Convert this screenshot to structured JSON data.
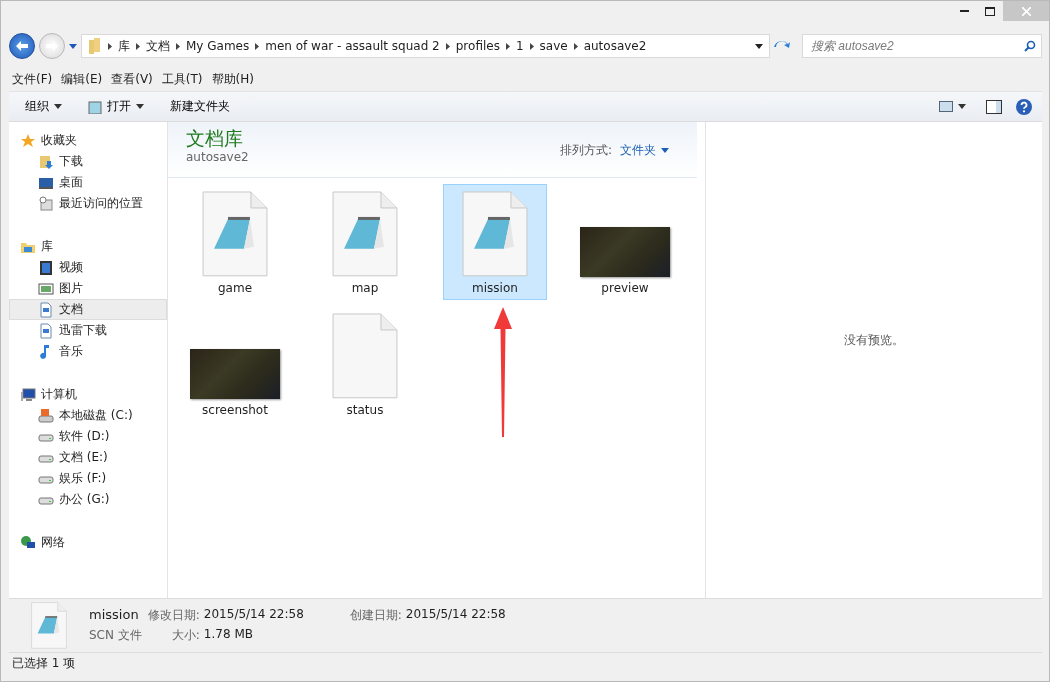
{
  "address": {
    "crumbs": [
      "库",
      "文档",
      "My Games",
      "men of war - assault squad 2",
      "profiles",
      "1",
      "save",
      "autosave2"
    ]
  },
  "search": {
    "placeholder": "搜索 autosave2"
  },
  "menu": [
    "文件(F)",
    "编辑(E)",
    "查看(V)",
    "工具(T)",
    "帮助(H)"
  ],
  "toolbar": [
    {
      "label": "组织",
      "kind": "dropdown"
    },
    {
      "label": "打开",
      "kind": "open"
    },
    {
      "label": "新建文件夹",
      "kind": "plain"
    }
  ],
  "sidebar": [
    {
      "label": "收藏夹",
      "kind": "star",
      "selected": false,
      "children": [
        {
          "label": "下载",
          "kind": "download",
          "selected": false
        },
        {
          "label": "桌面",
          "kind": "desktop",
          "selected": false
        },
        {
          "label": "最近访问的位置",
          "kind": "recent",
          "selected": false
        }
      ]
    },
    {
      "label": "库",
      "kind": "library",
      "selected": false,
      "children": [
        {
          "label": "视频",
          "kind": "video",
          "selected": false
        },
        {
          "label": "图片",
          "kind": "picture",
          "selected": false
        },
        {
          "label": "文档",
          "kind": "document",
          "selected": true
        },
        {
          "label": "迅雷下载",
          "kind": "document",
          "selected": false
        },
        {
          "label": "音乐",
          "kind": "music",
          "selected": false
        }
      ]
    },
    {
      "label": "计算机",
      "kind": "computer",
      "selected": false,
      "children": [
        {
          "label": "本地磁盘 (C:)",
          "kind": "system-drive",
          "selected": false
        },
        {
          "label": "软件 (D:)",
          "kind": "drive",
          "selected": false
        },
        {
          "label": "文档 (E:)",
          "kind": "drive",
          "selected": false
        },
        {
          "label": "娱乐 (F:)",
          "kind": "drive",
          "selected": false
        },
        {
          "label": "办公 (G:)",
          "kind": "drive",
          "selected": false
        }
      ]
    },
    {
      "label": "网络",
      "kind": "network",
      "selected": false
    }
  ],
  "library": {
    "title": "文档库",
    "subtitle": "autosave2",
    "arrange_label": "排列方式:",
    "arrange_value": "文件夹"
  },
  "files": [
    {
      "name": "game",
      "kind": "text",
      "selected": false
    },
    {
      "name": "map",
      "kind": "text",
      "selected": false
    },
    {
      "name": "mission",
      "kind": "text",
      "selected": true
    },
    {
      "name": "preview",
      "kind": "image",
      "selected": false
    },
    {
      "name": "screenshot",
      "kind": "image",
      "selected": false
    },
    {
      "name": "status",
      "kind": "blank",
      "selected": false
    }
  ],
  "preview_pane": {
    "message": "没有预览。"
  },
  "details": {
    "name": "mission",
    "type": "SCN 文件",
    "fields": [
      {
        "label": "修改日期:",
        "value": "2015/5/14 22:58"
      },
      {
        "label": "创建日期:",
        "value": "2015/5/14 22:58"
      },
      {
        "label": "大小:",
        "value": "1.78 MB"
      }
    ]
  },
  "status_bar": {
    "text": "已选择 1 项"
  }
}
